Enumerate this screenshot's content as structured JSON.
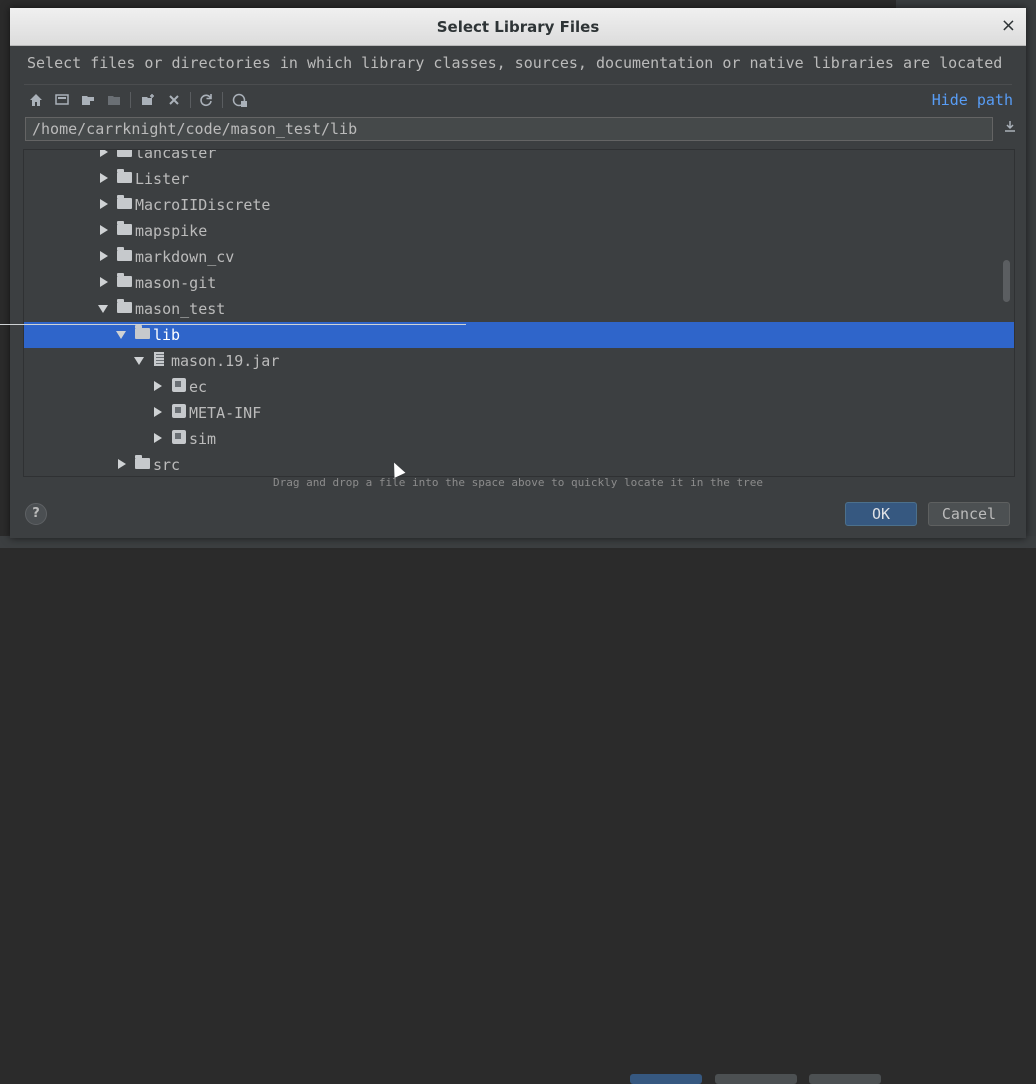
{
  "dialog": {
    "title": "Select Library Files",
    "close_glyph": "×",
    "description": "Select files or directories in which library classes, sources, documentation or native libraries are located",
    "hide_path_label": "Hide path",
    "path_value": "/home/carrknight/code/mason_test/lib",
    "hint": "Drag and drop a file into the space above to quickly locate it in the tree",
    "help_label": "?",
    "ok_label": "OK",
    "cancel_label": "Cancel"
  },
  "toolbar_icons": [
    "home-icon",
    "desktop-icon",
    "project-folder-icon",
    "module-folder-icon",
    "new-folder-icon",
    "delete-icon",
    "refresh-icon",
    "show-hidden-icon"
  ],
  "tree": {
    "rows": [
      {
        "label": "lancaster",
        "type": "folder",
        "expanded": false
      },
      {
        "label": "Lister",
        "type": "folder",
        "expanded": false
      },
      {
        "label": "MacroIIDiscrete",
        "type": "folder",
        "expanded": false
      },
      {
        "label": "mapspike",
        "type": "folder",
        "expanded": false
      },
      {
        "label": "markdown_cv",
        "type": "folder",
        "expanded": false
      },
      {
        "label": "mason-git",
        "type": "folder",
        "expanded": false
      },
      {
        "label": "mason_test",
        "type": "folder",
        "expanded": true
      },
      {
        "label": "lib",
        "type": "folder",
        "expanded": true,
        "selected": true
      },
      {
        "label": "mason.19.jar",
        "type": "jar",
        "expanded": true
      },
      {
        "label": "ec",
        "type": "package",
        "expanded": false
      },
      {
        "label": "META-INF",
        "type": "package",
        "expanded": false
      },
      {
        "label": "sim",
        "type": "package",
        "expanded": false
      },
      {
        "label": "src",
        "type": "folder",
        "expanded": false
      }
    ]
  },
  "colors": {
    "selection": "#2f65ca",
    "link": "#589df6",
    "ok_button": "#365880"
  }
}
